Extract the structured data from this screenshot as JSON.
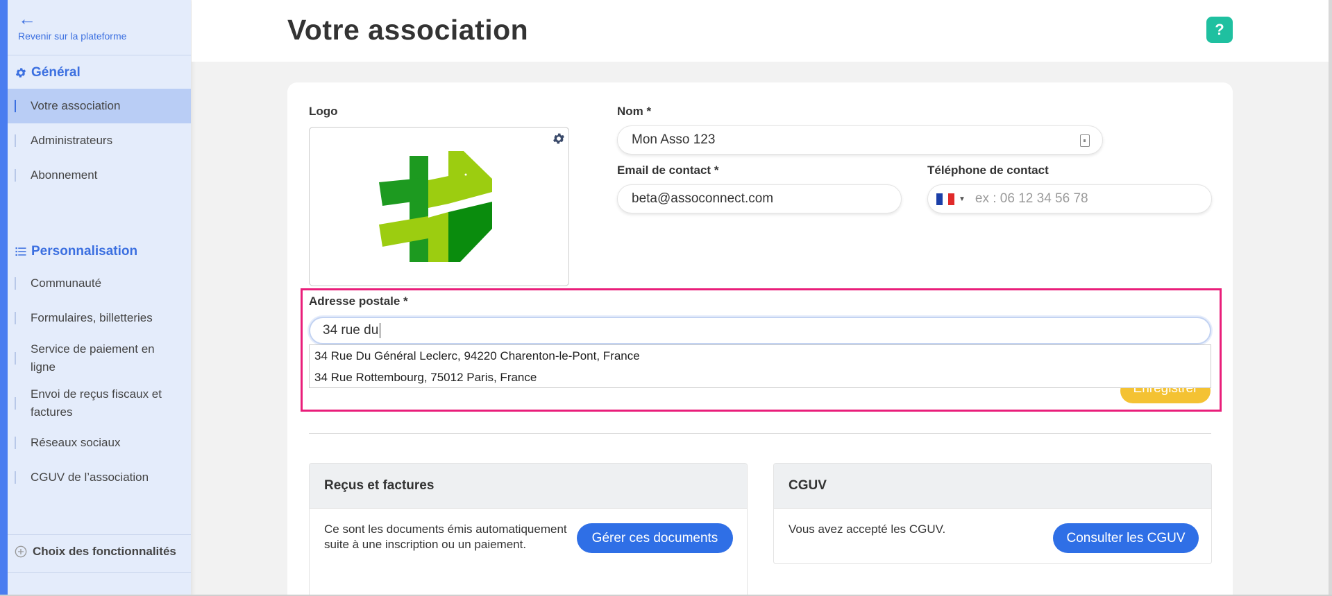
{
  "sidebar": {
    "back_label": "Revenir sur la plateforme",
    "general_heading": "Général",
    "general_items": [
      "Votre association",
      "Administrateurs",
      "Abonnement"
    ],
    "perso_heading": "Personnalisation",
    "perso_items": [
      "Communauté",
      "Formulaires, billetteries",
      "Service de paiement en ligne",
      "Envoi de reçus fiscaux et factures",
      "Réseaux sociaux",
      "CGUV de l’association"
    ],
    "features_label": "Choix des fonctionnalités"
  },
  "header": {
    "title": "Votre association",
    "help": "?"
  },
  "form": {
    "logo_label": "Logo",
    "name_label": "Nom *",
    "name_value": "Mon Asso 123",
    "email_label": "Email de contact *",
    "email_value": "beta@assoconnect.com",
    "phone_label": "Téléphone de contact",
    "phone_placeholder": "ex : 06 12 34 56 78",
    "address_label": "Adresse postale *",
    "address_value": "34 rue du",
    "suggestions": [
      "34 Rue Du Général Leclerc, 94220 Charenton-le-Pont, France",
      "34 Rue Rottembourg, 75012 Paris, France"
    ],
    "save_label": "Enregistrer"
  },
  "receipts": {
    "title": "Reçus et factures",
    "text": "Ce sont les documents émis automatiquement suite à une inscription ou un paiement.",
    "button": "Gérer ces documents"
  },
  "cguv": {
    "title": "CGUV",
    "text": "Vous avez accepté les CGUV.",
    "button": "Consulter les CGUV"
  },
  "colors": {
    "accent": "#3b6fe0",
    "highlight": "#e91e7a",
    "save": "#f4c233",
    "help": "#1fc0a0"
  }
}
